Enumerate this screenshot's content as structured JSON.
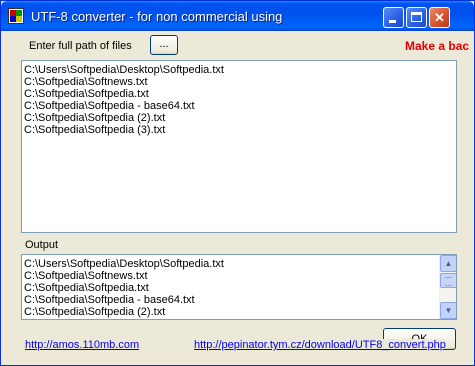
{
  "window": {
    "title": "UTF-8 converter - for non commercial using",
    "icon": "app-icon"
  },
  "controls": {
    "minimize": "minimize-icon",
    "maximize": "maximize-icon",
    "close": "close-icon"
  },
  "input_section": {
    "label": "Enter full path of files",
    "browse_label": "...",
    "promo_text": "Make a bac"
  },
  "input_files": [
    "C:\\Users\\Softpedia\\Desktop\\Softpedia.txt",
    "C:\\Softpedia\\Softnews.txt",
    "C:\\Softpedia\\Softpedia.txt",
    "C:\\Softpedia\\Softpedia - base64.txt",
    "C:\\Softpedia\\Softpedia (2).txt",
    "C:\\Softpedia\\Softpedia (3).txt"
  ],
  "output_section": {
    "label": "Output",
    "items": [
      "C:\\Users\\Softpedia\\Desktop\\Softpedia.txt",
      "C:\\Softpedia\\Softnews.txt",
      "C:\\Softpedia\\Softpedia.txt",
      "C:\\Softpedia\\Softpedia - base64.txt",
      "C:\\Softpedia\\Softpedia (2).txt"
    ]
  },
  "footer": {
    "ok_label": "OK",
    "link_left": "http://amos.110mb.com",
    "link_right": "http://pepinator.tym.cz/download/UTF8_convert.php"
  },
  "colors": {
    "promo": "#e00000",
    "link": "#0000ee",
    "titlebar": "#0053ee"
  }
}
